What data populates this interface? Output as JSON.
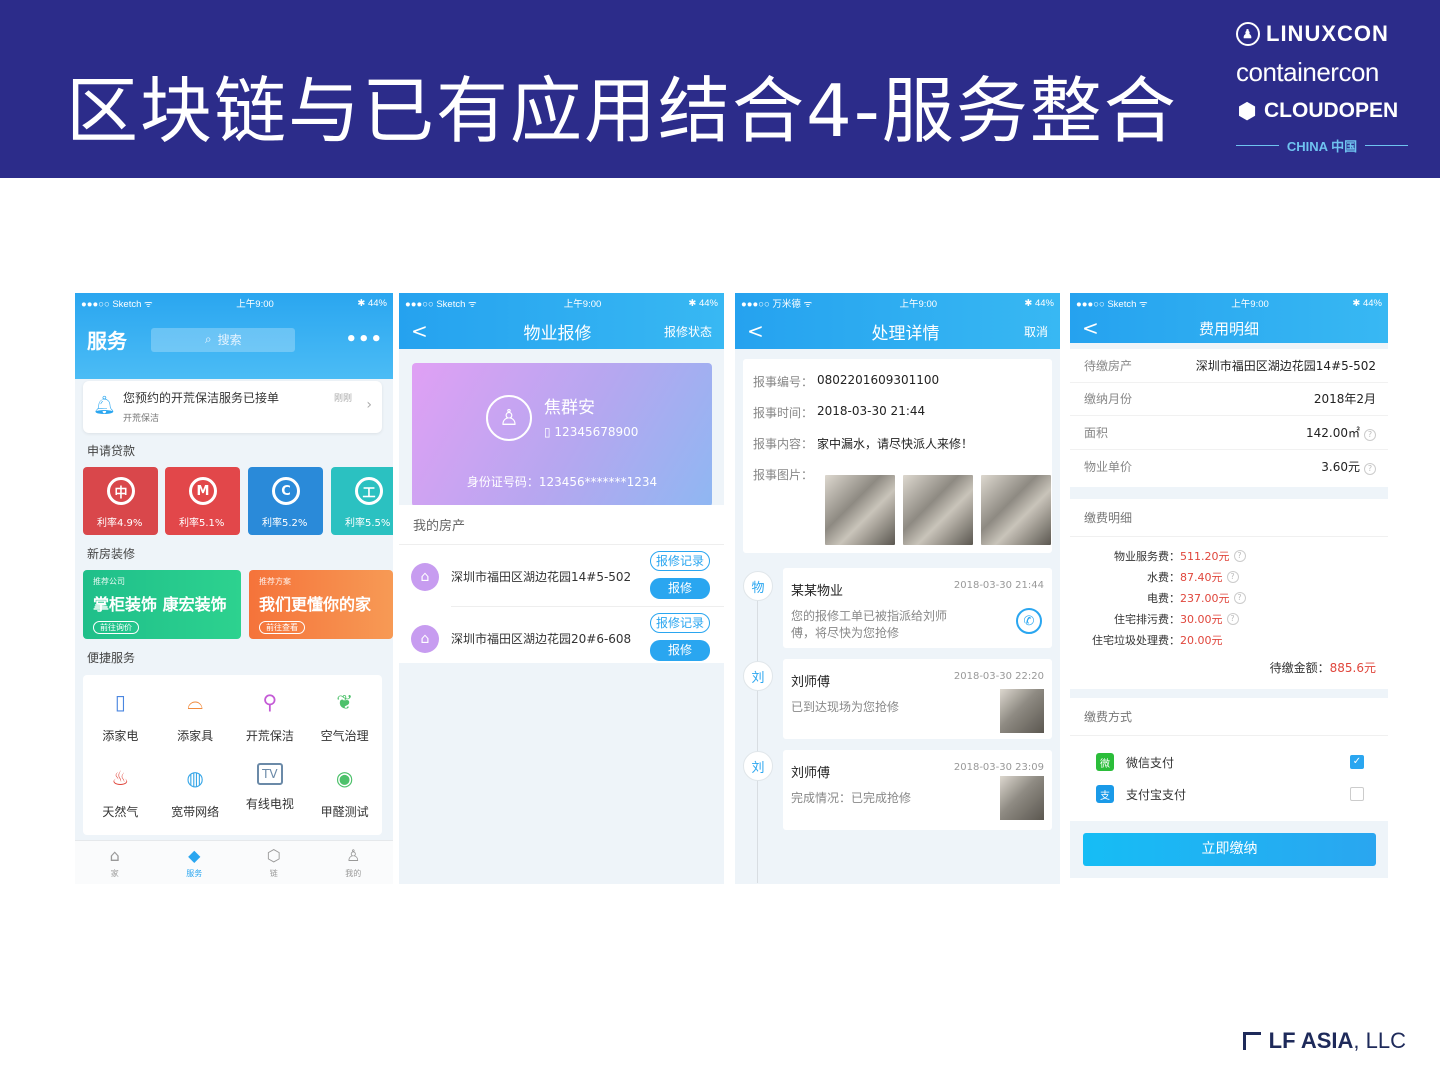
{
  "slide": {
    "title": "区块链与已有应用结合4-服务整合",
    "brand": {
      "line1": "LINUXCON",
      "line2": "containercon",
      "line3": "CLOUDOPEN",
      "line4": "CHINA 中国"
    },
    "footer": {
      "name": "LF ASIA",
      "suffix": ", LLC"
    }
  },
  "phone1": {
    "status": {
      "carrier": "●●●○○ Sketch ᯤ",
      "time": "上午9:00",
      "battery": "✱ 44%"
    },
    "header_title": "服务",
    "search_placeholder": "搜索",
    "more": "•••",
    "notice": {
      "text": "您预约的开荒保洁服务已接单",
      "sub": "开荒保洁",
      "time": "刚刚"
    },
    "sections": {
      "loan": "申请贷款",
      "deco": "新房装修",
      "svc": "便捷服务"
    },
    "loans": [
      {
        "rate": "利率4.9%",
        "color": "#d9474b",
        "icon": "中"
      },
      {
        "rate": "利率5.1%",
        "color": "#e2474a",
        "icon": "M"
      },
      {
        "rate": "利率5.2%",
        "color": "#2a8ad9",
        "icon": "C"
      },
      {
        "rate": "利率5.5%",
        "color": "#2bc1c1",
        "icon": "工"
      }
    ],
    "deco": [
      {
        "tag": "推荐公司",
        "name": "掌柜装饰  康宏装饰",
        "btn": "前往询价",
        "color": "#1fbf8a"
      },
      {
        "tag": "推荐方案",
        "name": "我们更懂你的家",
        "btn": "前往查看",
        "color": "#f5733a"
      }
    ],
    "services": [
      {
        "label": "添家电",
        "icon": "▯",
        "color": "#4a86e0"
      },
      {
        "label": "添家具",
        "icon": "⌓",
        "color": "#f08a3c"
      },
      {
        "label": "开荒保洁",
        "icon": "⚲",
        "color": "#c45bd6"
      },
      {
        "label": "空气治理",
        "icon": "❦",
        "color": "#4cc16a"
      },
      {
        "label": "天然气",
        "icon": "♨",
        "color": "#e0463c"
      },
      {
        "label": "宽带网络",
        "icon": "◍",
        "color": "#3aa8e8"
      },
      {
        "label": "有线电视",
        "icon": "TV",
        "color": "#6b8aa8"
      },
      {
        "label": "甲醛测试",
        "icon": "◉",
        "color": "#4cc16a"
      }
    ],
    "tabs": [
      {
        "label": "家",
        "icon": "⌂"
      },
      {
        "label": "服务",
        "icon": "◆"
      },
      {
        "label": "链",
        "icon": "⬡"
      },
      {
        "label": "我的",
        "icon": "♙"
      }
    ]
  },
  "phone2": {
    "status": {
      "carrier": "●●●○○ Sketch ᯤ",
      "time": "上午9:00",
      "battery": "✱ 44%"
    },
    "nav": {
      "back": "<",
      "title": "物业报修",
      "right": "报修状态"
    },
    "card": {
      "name": "焦群安",
      "phone": "12345678900",
      "id": "身份证号码：123456*******1234"
    },
    "list_header": "我的房产",
    "properties": [
      {
        "addr": "深圳市福田区湖边花园14#5-502",
        "record": "报修记录",
        "action": "报修"
      },
      {
        "addr": "深圳市福田区湖边花园20#6-608",
        "record": "报修记录",
        "action": "报修"
      }
    ]
  },
  "phone3": {
    "status": {
      "carrier": "●●●○○ 万米德 ᯤ",
      "time": "上午9:00",
      "battery": "✱ 44%"
    },
    "nav": {
      "back": "<",
      "title": "处理详情",
      "right": "取消"
    },
    "info": [
      {
        "k": "报事编号：",
        "v": "0802201609301100"
      },
      {
        "k": "报事时间：",
        "v": "2018-03-30 21:44"
      },
      {
        "k": "报事内容：",
        "v": "家中漏水，请尽快派人来修！"
      },
      {
        "k": "报事图片：",
        "v": ""
      }
    ],
    "timeline": [
      {
        "dot": "物",
        "name": "某某物业",
        "time": "2018-03-30 21:44",
        "msg": "您的报修工单已被指派给刘师\n傅，将尽快为您抢修"
      },
      {
        "dot": "刘",
        "name": "刘师傅",
        "time": "2018-03-30 22:20",
        "msg": "已到达现场为您抢修"
      },
      {
        "dot": "刘",
        "name": "刘师傅",
        "time": "2018-03-30 23:09",
        "msg": "完成情况：已完成抢修"
      }
    ]
  },
  "phone4": {
    "status": {
      "carrier": "●●●○○ Sketch ᯤ",
      "time": "上午9:00",
      "battery": "✱ 44%"
    },
    "nav": {
      "back": "<",
      "title": "费用明细"
    },
    "rows": [
      {
        "k": "待缴房产",
        "v": "深圳市福田区湖边花园14#5-502"
      },
      {
        "k": "缴纳月份",
        "v": "2018年2月"
      },
      {
        "k": "面积",
        "v": "142.00㎡"
      },
      {
        "k": "物业单价",
        "v": "3.60元"
      }
    ],
    "detail_header": "缴费明细",
    "fees": [
      {
        "k": "物业服务费：",
        "v": "511.20元"
      },
      {
        "k": "水费：",
        "v": "87.40元"
      },
      {
        "k": "电费：",
        "v": "237.00元"
      },
      {
        "k": "住宅排污费：",
        "v": "30.00元"
      },
      {
        "k": "住宅垃圾处理费：",
        "v": "20.00元"
      }
    ],
    "total_label": "待缴金额：",
    "total_value": "885.6元",
    "pay_header": "缴费方式",
    "pays": [
      {
        "label": "微信支付",
        "icon": "微",
        "color": "#2bbd3a",
        "checked": true
      },
      {
        "label": "支付宝支付",
        "icon": "支",
        "color": "#1a9ae8",
        "checked": false
      }
    ],
    "button": "立即缴纳"
  }
}
